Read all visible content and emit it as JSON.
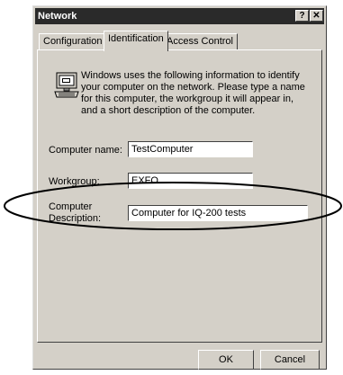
{
  "window": {
    "title": "Network",
    "help_label": "?",
    "close_label": "✕"
  },
  "tabs": [
    {
      "label": "Configuration",
      "active": false
    },
    {
      "label": "Identification",
      "active": true
    },
    {
      "label": "Access Control",
      "active": false
    }
  ],
  "identification": {
    "intro": "Windows uses the following information to identify your computer on the network.  Please type a name for this computer, the workgroup it will appear in, and a short description of the computer.",
    "computer_name_label": "Computer name:",
    "computer_name_value": "TestComputer",
    "workgroup_label": "Workgroup:",
    "workgroup_value": "EXFO",
    "description_label_line1": "Computer",
    "description_label_line2": "Description:",
    "description_value": "Computer for IQ-200 tests"
  },
  "buttons": {
    "ok": "OK",
    "cancel": "Cancel"
  }
}
